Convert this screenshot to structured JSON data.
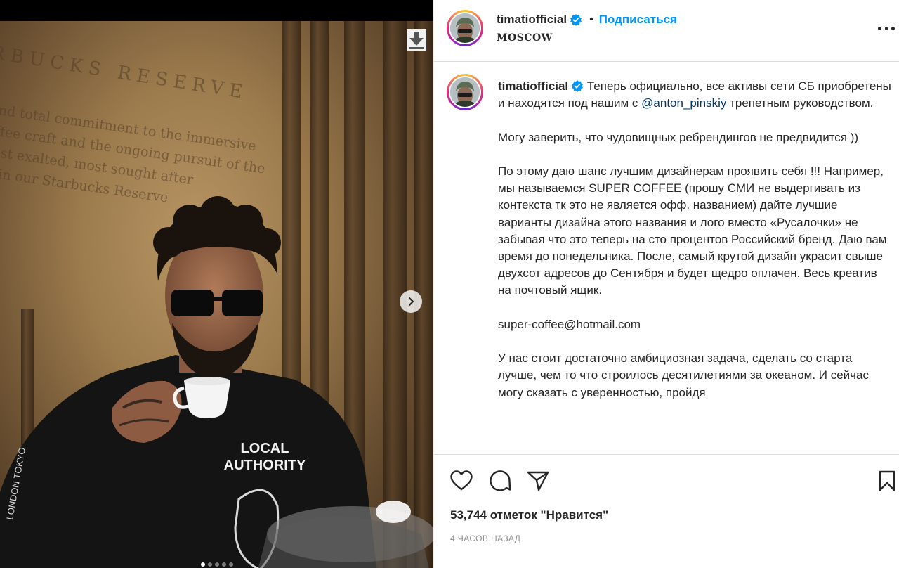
{
  "media": {
    "wall_title": "RBUCKS RESERVE",
    "wall_lines": [
      "nd total commitment to the immersive",
      "ffee craft and the ongoing pursuit of the",
      "ost exalted, most sought after",
      "l in our Starbucks Reserve"
    ],
    "shirt_text": [
      "LOCAL",
      "AUTHORITY"
    ],
    "sleeve_text": "LONDON TOKYO",
    "carousel": {
      "count": 5,
      "active": 1
    },
    "next_icon": "chevron-right-icon",
    "download_icon": "download-arrow-icon"
  },
  "post": {
    "username": "timatiofficial",
    "verified": true,
    "separator": "•",
    "follow_label": "Подписаться",
    "location": "MOSCOW",
    "more_icon": "more-horizontal-icon",
    "caption": {
      "p1_text": "Теперь официально, все активы сети СБ приобретены и находятся под нашим с",
      "p1_mention": "@anton_pinskiy",
      "p1_after": "трепетным руководством.",
      "p2": "Могу заверить, что чудовищных ребрендингов не предвидится ))",
      "p3": "По этому даю шанс лучшим дизайнерам проявить себя !!! Например, мы называемся SUPER COFFEE (прошу СМИ не выдергивать из контекста тк это не является офф. названием) дайте лучшие варианты дизайна этого названия и лого вместо «Русалочки» не забывая что это теперь на сто процентов Российский бренд. Даю вам время до понедельника. После, самый крутой дизайн украсит свыше двухсот адресов до Сентября и будет щедро оплачен. Весь креатив на почтовый ящик.",
      "p4": "super-coffee@hotmail.com",
      "p5": "У нас стоит достаточно амбициозная задача, сделать со старта лучше, чем то что строилось десятилетиями за океаном. И сейчас могу сказать с уверенностью, пройдя"
    },
    "likes_text": "53,744 отметок \"Нравится\"",
    "time_ago": "4 ЧАСОВ НАЗАД",
    "colors": {
      "follow": "#0095f6",
      "verified": "#0095f6",
      "mention": "#00376b",
      "text": "#262626",
      "muted": "#8e8e8e",
      "divider": "#dbdbdb"
    }
  }
}
